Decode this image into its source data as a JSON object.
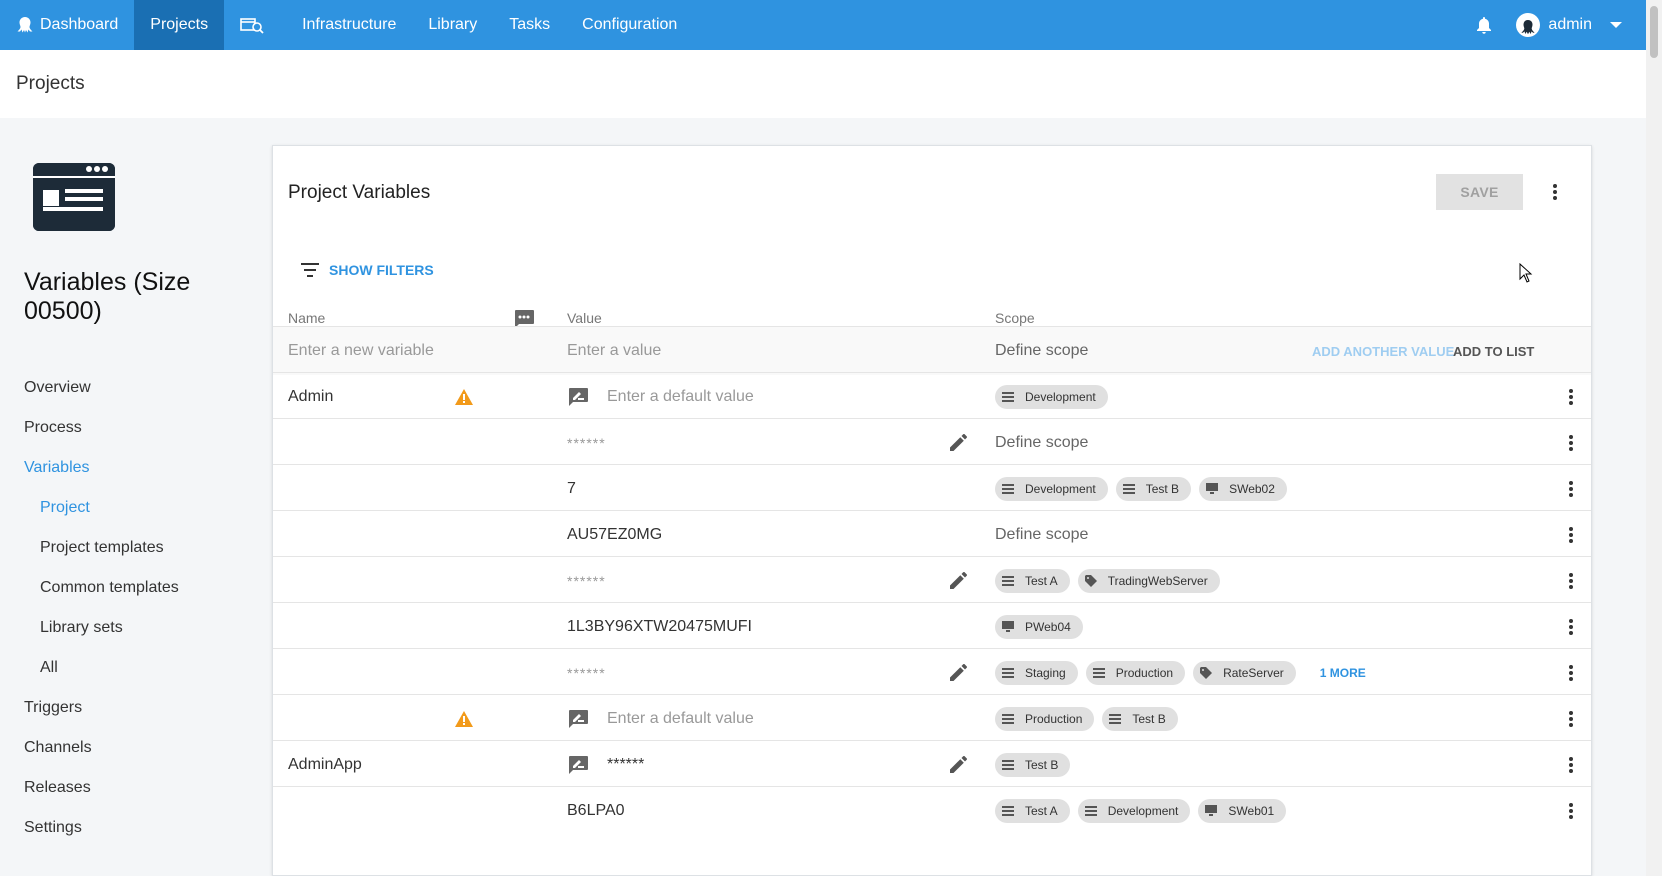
{
  "nav": {
    "dashboard": "Dashboard",
    "projects": "Projects",
    "infrastructure": "Infrastructure",
    "library": "Library",
    "tasks": "Tasks",
    "configuration": "Configuration",
    "user": "admin"
  },
  "page_header": "Projects",
  "project": {
    "title": "Variables (Size 00500)"
  },
  "sidebar": {
    "items": [
      {
        "label": "Overview"
      },
      {
        "label": "Process"
      },
      {
        "label": "Variables"
      },
      {
        "label": "Project"
      },
      {
        "label": "Project templates"
      },
      {
        "label": "Common templates"
      },
      {
        "label": "Library sets"
      },
      {
        "label": "All"
      },
      {
        "label": "Triggers"
      },
      {
        "label": "Channels"
      },
      {
        "label": "Releases"
      },
      {
        "label": "Settings"
      }
    ]
  },
  "card": {
    "title": "Project Variables",
    "save_label": "SAVE",
    "show_filters": "SHOW FILTERS",
    "columns": {
      "name": "Name",
      "value": "Value",
      "scope": "Scope"
    },
    "new_row": {
      "name_placeholder": "Enter a new variable",
      "value_placeholder": "Enter a value",
      "scope_placeholder": "Define scope",
      "add_another": "ADD ANOTHER VALUE",
      "add_to_list": "ADD TO LIST"
    }
  },
  "rows": [
    {
      "name": "Admin",
      "value": "Enter a default value",
      "scope_text": "",
      "chips": [
        "Development"
      ]
    },
    {
      "name": "",
      "value": "******",
      "scope_text": "Define scope",
      "chips": []
    },
    {
      "name": "",
      "value": "7",
      "scope_text": "",
      "chips": [
        "Development",
        "Test B",
        "SWeb02"
      ]
    },
    {
      "name": "",
      "value": "AU57EZ0MG",
      "scope_text": "Define scope",
      "chips": []
    },
    {
      "name": "",
      "value": "******",
      "scope_text": "",
      "chips": [
        "Test A",
        "TradingWebServer"
      ]
    },
    {
      "name": "",
      "value": "1L3BY96XTW20475MUFI",
      "scope_text": "",
      "chips": [
        "PWeb04"
      ]
    },
    {
      "name": "",
      "value": "******",
      "scope_text": "",
      "chips": [
        "Staging",
        "Production",
        "RateServer"
      ],
      "more": "1 MORE"
    },
    {
      "name": "",
      "value": "Enter a default value",
      "scope_text": "",
      "chips": [
        "Production",
        "Test B"
      ]
    },
    {
      "name": "AdminApp",
      "value": "******",
      "scope_text": "",
      "chips": [
        "Test B"
      ]
    },
    {
      "name": "",
      "value": "B6LPA0",
      "scope_text": "",
      "chips": [
        "Test A",
        "Development",
        "SWeb01"
      ]
    }
  ],
  "colors": {
    "nav_bg": "#2f93e0",
    "nav_active": "#1a6fb3",
    "accent": "#2f93e0",
    "warning": "#f29a1a"
  }
}
